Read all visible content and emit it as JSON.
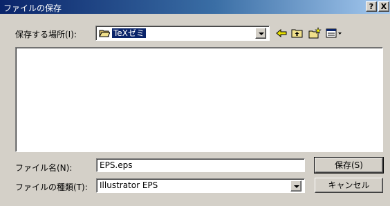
{
  "window": {
    "title": "ファイルの保存",
    "help_label": "?",
    "close_label": "X"
  },
  "save_in": {
    "label": "保存する場所(I):",
    "folder_name": "TeXゼミ"
  },
  "icons": {
    "folder": "open-folder-icon",
    "back": "back-arrow-icon",
    "up": "up-folder-icon",
    "new_folder": "new-folder-icon",
    "view_menu": "view-menu-icon"
  },
  "file_name": {
    "label": "ファイル名(N):",
    "value": "EPS.eps"
  },
  "file_type": {
    "label": "ファイルの種類(T):",
    "value": "Illustrator EPS"
  },
  "buttons": {
    "save": "保存(S)",
    "cancel": "キャンセル"
  }
}
